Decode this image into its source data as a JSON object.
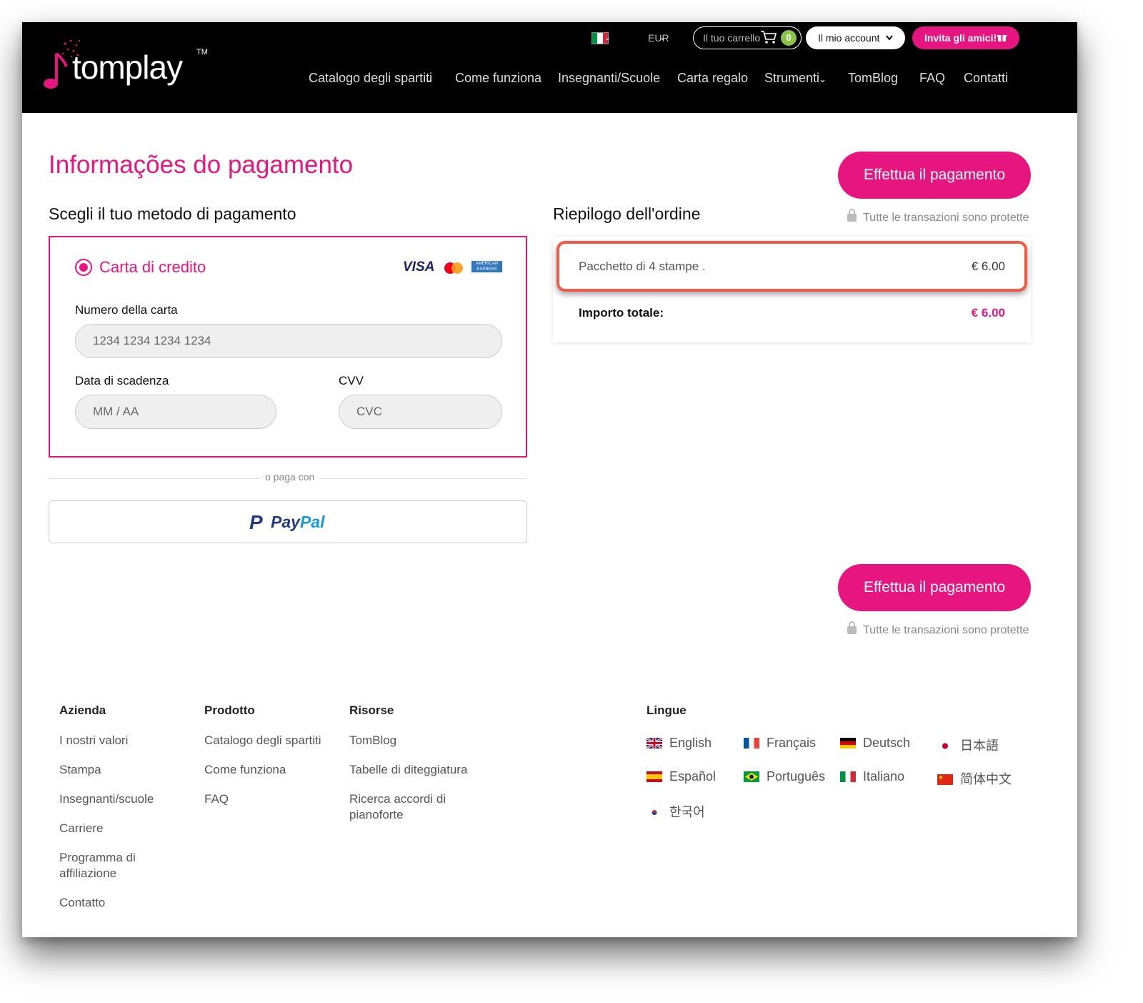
{
  "header": {
    "logo_text": "tomplay",
    "logo_tm": "TM",
    "currency": "EUR",
    "cart_label": "Il tuo carrello",
    "cart_count": "0",
    "account_label": "Il mio account",
    "invite_label": "Invita gli amici!",
    "nav": [
      "Catalogo degli spartiti",
      "Come funziona",
      "Insegnanti/Scuole",
      "Carta regalo",
      "Strumenti",
      "TomBlog",
      "FAQ",
      "Contatti"
    ]
  },
  "main": {
    "title": "Informações do pagamento",
    "pay_button": "Effettua il pagamento",
    "secure_text": "Tutte le transazioni sono protette",
    "method_title": "Scegli il tuo metodo di pagamento",
    "credit_card_label": "Carta di credito",
    "card_logos": {
      "visa": "VISA",
      "amex": "AMERICAN EXPRESS"
    },
    "card_number_label": "Numero della carta",
    "card_number_placeholder": "1234 1234 1234 1234",
    "expiry_label": "Data di scadenza",
    "expiry_placeholder": "MM / AA",
    "cvv_label": "CVV",
    "cvv_placeholder": "CVC",
    "or_pay_with": "o paga con",
    "paypal": {
      "pay": "Pay",
      "pal": "Pal"
    }
  },
  "order": {
    "title": "Riepilogo dell'ordine",
    "item_name": "Pacchetto di 4 stampe .",
    "item_price": "€ 6.00",
    "total_label": "Importo totale:",
    "total_value": "€ 6.00"
  },
  "footer": {
    "azienda": {
      "title": "Azienda",
      "links": [
        "I nostri valori",
        "Stampa",
        "Insegnanti/scuole",
        "Carriere",
        "Programma di affiliazione",
        "Contatto"
      ]
    },
    "prodotto": {
      "title": "Prodotto",
      "links": [
        "Catalogo degli spartiti",
        "Come funziona",
        "FAQ"
      ]
    },
    "risorse": {
      "title": "Risorse",
      "links": [
        "TomBlog",
        "Tabelle di diteggiatura",
        "Ricerca accordi di pianoforte"
      ]
    },
    "lingue": {
      "title": "Lingue",
      "languages": [
        "English",
        "Français",
        "Deutsch",
        "日本語",
        "Español",
        "Português",
        "Italiano",
        "简体中文",
        "한국어"
      ]
    }
  },
  "colors": {
    "brand": "#e6157f",
    "highlight": "#f05a48",
    "cart_badge": "#8bc34a"
  }
}
